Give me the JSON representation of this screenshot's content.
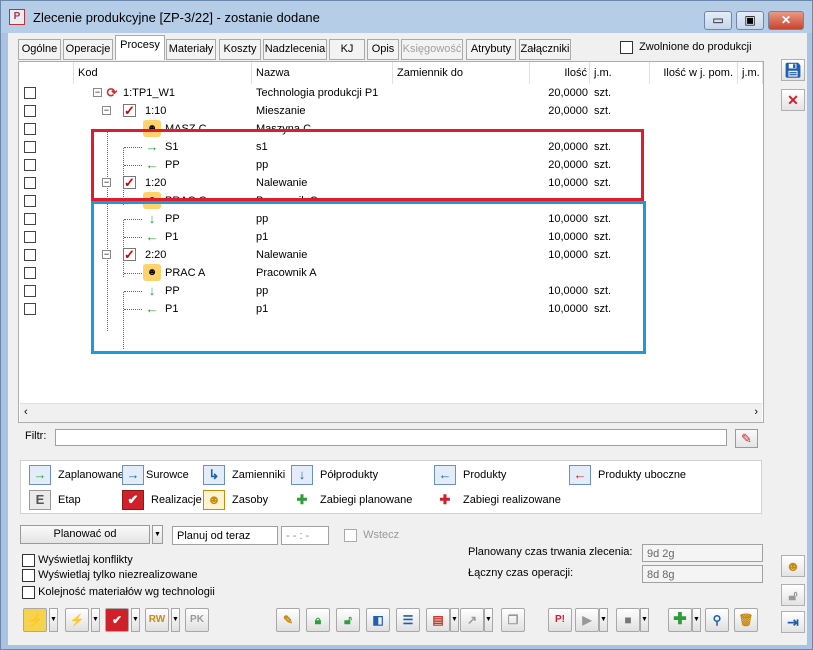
{
  "window": {
    "title": "Zlecenie produkcyjne  [ZP-3/22] - zostanie dodane",
    "minimize": "▭",
    "maximize": "▣",
    "close": "✕"
  },
  "tabs": [
    {
      "label": "Ogólne",
      "active": false,
      "disabled": false
    },
    {
      "label": "Operacje",
      "active": false,
      "disabled": false
    },
    {
      "label": "Procesy",
      "active": true,
      "disabled": false
    },
    {
      "label": "Materiały",
      "active": false,
      "disabled": false
    },
    {
      "label": "Koszty",
      "active": false,
      "disabled": false
    },
    {
      "label": "Nadzlecenia",
      "active": false,
      "disabled": false
    },
    {
      "label": "KJ",
      "active": false,
      "disabled": false
    },
    {
      "label": "Opis",
      "active": false,
      "disabled": false
    },
    {
      "label": "Księgowość",
      "active": false,
      "disabled": true
    },
    {
      "label": "Atrybuty",
      "active": false,
      "disabled": false
    },
    {
      "label": "Załączniki",
      "active": false,
      "disabled": false
    }
  ],
  "zwolnione": "Zwolnione do produkcji",
  "grid": {
    "headers": {
      "kod": "Kod",
      "nazwa": "Nazwa",
      "zamiennik": "Zamiennik do",
      "ilosc": "Ilość",
      "jm": "j.m.",
      "ilosc_pom": "Ilość w j. pom.",
      "jm2": "j.m."
    },
    "rows": [
      {
        "kod": "1:TP1_W1",
        "nazwa": "Technologia produkcji P1",
        "ilosc": "20,0000",
        "jm": "szt."
      },
      {
        "kod": "1:10",
        "nazwa": "Mieszanie",
        "ilosc": "20,0000",
        "jm": "szt."
      },
      {
        "kod": "MASZ C",
        "nazwa": "Maszyna C",
        "ilosc": "",
        "jm": ""
      },
      {
        "kod": "S1",
        "nazwa": "s1",
        "ilosc": "20,0000",
        "jm": "szt."
      },
      {
        "kod": "PP",
        "nazwa": "pp",
        "ilosc": "20,0000",
        "jm": "szt."
      },
      {
        "kod": "1:20",
        "nazwa": "Nalewanie",
        "ilosc": "10,0000",
        "jm": "szt."
      },
      {
        "kod": "PRAC C",
        "nazwa": "Pracownik C",
        "ilosc": "",
        "jm": ""
      },
      {
        "kod": "PP",
        "nazwa": "pp",
        "ilosc": "10,0000",
        "jm": "szt."
      },
      {
        "kod": "P1",
        "nazwa": "p1",
        "ilosc": "10,0000",
        "jm": "szt."
      },
      {
        "kod": "2:20",
        "nazwa": "Nalewanie",
        "ilosc": "10,0000",
        "jm": "szt."
      },
      {
        "kod": "PRAC A",
        "nazwa": "Pracownik A",
        "ilosc": "",
        "jm": ""
      },
      {
        "kod": "PP",
        "nazwa": "pp",
        "ilosc": "10,0000",
        "jm": "szt."
      },
      {
        "kod": "P1",
        "nazwa": "p1",
        "ilosc": "10,0000",
        "jm": "szt."
      }
    ]
  },
  "filter": {
    "label": "Filtr:",
    "value": ""
  },
  "legend": [
    {
      "label": "Zaplanowane",
      "icon": "→",
      "color": "#2e9e3a"
    },
    {
      "label": "Surowce",
      "icon": "→",
      "color": "#1f5fb0"
    },
    {
      "label": "Zamienniki",
      "icon": "↳",
      "color": "#1f5fb0"
    },
    {
      "label": "Półprodukty",
      "icon": "↓",
      "color": "#1f5fb0"
    },
    {
      "label": "Produkty",
      "icon": "←",
      "color": "#1f5fb0"
    },
    {
      "label": "Produkty uboczne",
      "icon": "←",
      "color": "#d0202a"
    },
    {
      "label": "Etap",
      "icon": "E",
      "color": "#555555"
    },
    {
      "label": "Realizacje",
      "icon": "✔",
      "color": "#d0202a"
    },
    {
      "label": "Zasoby",
      "icon": "☻",
      "color": "#c98a10"
    },
    {
      "label": "Zabiegi planowane",
      "icon": "✚",
      "color": "#2e9e3a"
    },
    {
      "label": "Zabiegi realizowane",
      "icon": "✚",
      "color": "#d0202a"
    }
  ],
  "planning": {
    "plan_label": "Planować od",
    "from_value": "Planuj od teraz",
    "time_placeholder": "- - : -",
    "wstecz": "Wstecz",
    "planned_duration_label": "Planowany czas trwania zlecenia:",
    "planned_duration_value": "9d 2g",
    "total_time_label": "Łączny czas operacji:",
    "total_time_value": "8d 8g"
  },
  "options": {
    "conflicts": "Wyświetlaj konflikty",
    "unrealized": "Wyświetlaj tylko niezrealizowane",
    "order": "Kolejność materiałów wg technologii"
  },
  "toolbar_icons": [
    "lightning-icon",
    "green-lightning-icon",
    "realizacje-icon",
    "rw-icon",
    "pk-icon",
    "edit-icon",
    "lock-icon",
    "unlock-icon",
    "split-icon",
    "gantt-icon",
    "chart-icon",
    "graph-icon",
    "copy-icon",
    "priority-icon",
    "play-icon",
    "stop-icon",
    "add-icon",
    "search-icon",
    "delete-icon"
  ],
  "toolbar_text": {
    "rw": "RW",
    "pk": "PK",
    "priority": "P!"
  }
}
